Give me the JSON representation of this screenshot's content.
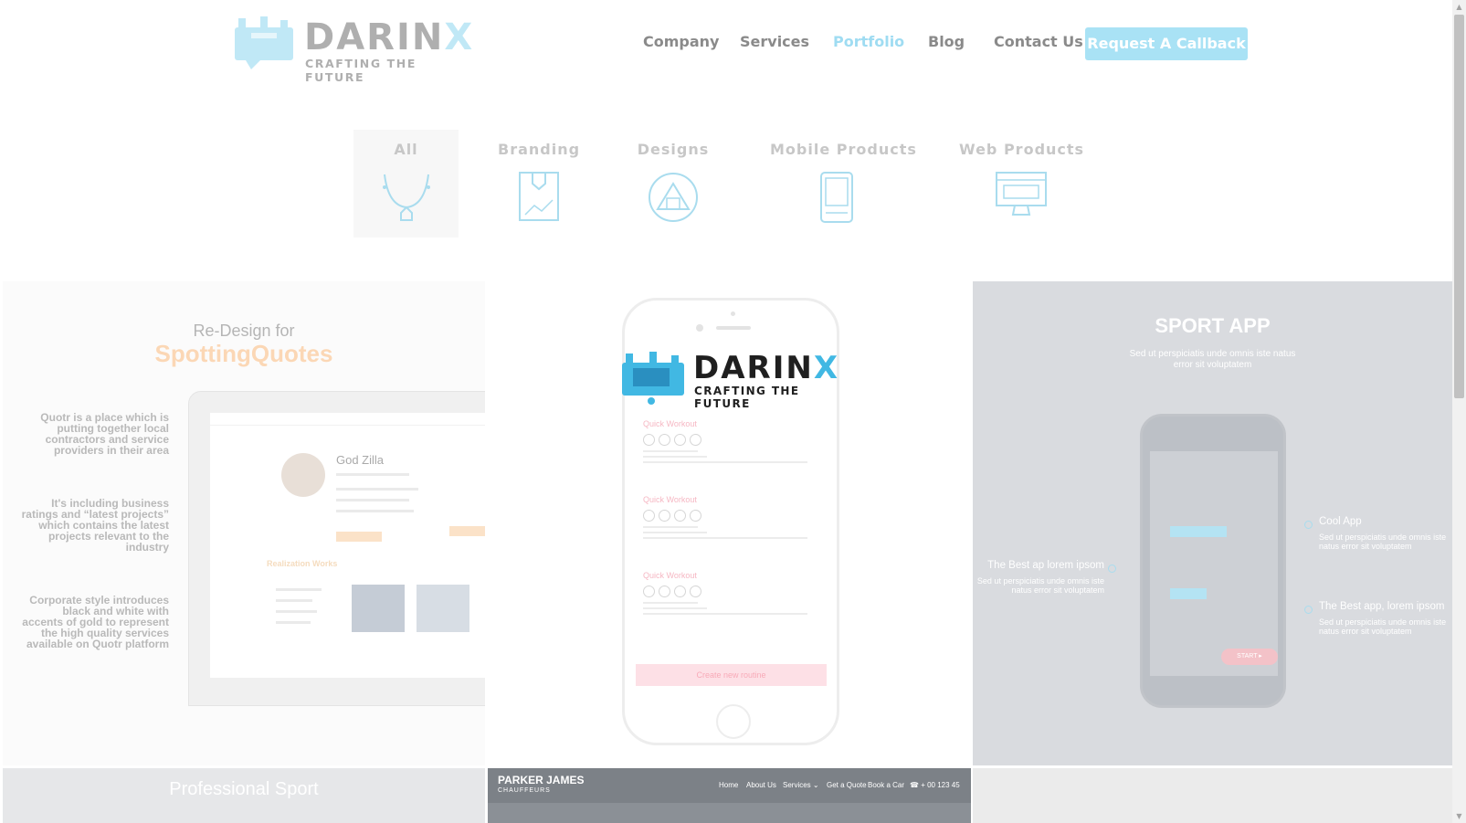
{
  "header": {
    "logo": {
      "word": "DARIN",
      "word_accent": "X",
      "tagline": "CRAFTING THE FUTURE"
    },
    "nav": [
      {
        "label": "Company",
        "active": false
      },
      {
        "label": "Services",
        "active": false
      },
      {
        "label": "Portfolio",
        "active": true
      },
      {
        "label": "Blog",
        "active": false
      },
      {
        "label": "Contact Us",
        "active": false
      }
    ],
    "cta_label": "Request A Callback"
  },
  "filters": [
    {
      "label": "All",
      "icon": "pen-tool-icon",
      "selected": true
    },
    {
      "label": "Branding",
      "icon": "frame-icon",
      "selected": false
    },
    {
      "label": "Designs",
      "icon": "shapes-icon",
      "selected": false
    },
    {
      "label": "Mobile Products",
      "icon": "mobile-icon",
      "selected": false
    },
    {
      "label": "Web Products",
      "icon": "desktop-icon",
      "selected": false
    }
  ],
  "portfolio": {
    "spotting": {
      "title": "Re-Design for",
      "brand": "SpottingQuotes",
      "notes": [
        "Quotr is a place which is putting together local contractors and service providers in their area",
        "It's including business ratings and “latest projects” which contains the latest projects relevant to the industry",
        "Corporate style introduces black and white with accents of gold to represent the high quality services available on Quotr platform"
      ],
      "screen_name": "God Zilla",
      "screen_subheading": "Realization Works"
    },
    "workout": {
      "logo_word": "DARIN",
      "logo_accent": "X",
      "logo_tagline": "CRAFTING THE FUTURE",
      "items": [
        "Quick Workout",
        "Quick Workout",
        "Quick Workout"
      ],
      "button": "Create new routine"
    },
    "sport": {
      "title": "SPORT APP",
      "subtitle": "Sed ut perspiciatis unde omnis iste natus error sit voluptatem",
      "callouts": [
        {
          "title": "Cool App",
          "text": "Sed ut perspiciatis unde omnis iste natus error sit voluptatem"
        },
        {
          "title": "The Best ap lorem ipsom",
          "text": "Sed ut perspiciatis unde omnis iste natus error sit voluptatem"
        },
        {
          "title": "The Best app, lorem ipsom",
          "text": "Sed ut perspiciatis unde omnis iste natus error sit voluptatem"
        }
      ],
      "start_label": "START ▸"
    },
    "professional": {
      "title": "Professional Sport"
    },
    "parker": {
      "brand": "PARKER JAMES",
      "brand_sub": "CHAUFFEURS",
      "links": [
        "Home",
        "About Us",
        "Services ⌄",
        "Get a Quote",
        "Book a Car",
        "☎ + 00 123 45"
      ]
    }
  },
  "colors": {
    "accent": "#41b8e3",
    "accent_light": "#a9e2f5",
    "brand_gold": "#fbd7b5",
    "pink": "#f6b7c3"
  }
}
